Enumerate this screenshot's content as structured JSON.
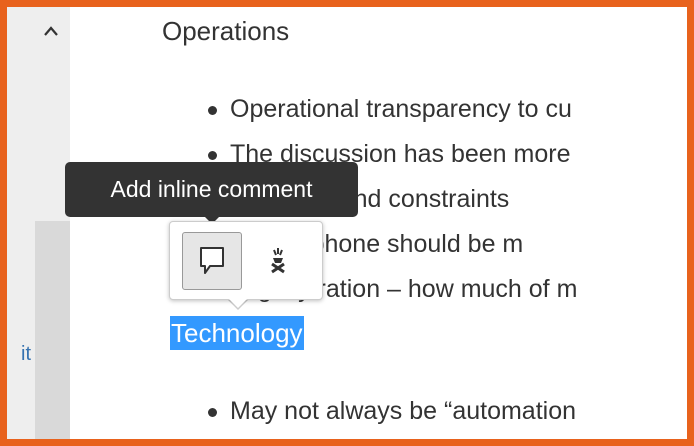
{
  "document": {
    "heading": "Operations",
    "bullets": [
      "Operational transparency to cu",
      "The discussion has been more",
      "Accuracy and constraints",
      "mobile phone should be m",
      "Legacy ration – how much of m",
      "May not always be “automation"
    ],
    "selected_heading": "Technology"
  },
  "sidebar": {
    "link_fragment": "it",
    "scroll_up_icon": "chevron-up-icon"
  },
  "tooltip": {
    "text": "Add inline comment"
  },
  "inline_toolbar": {
    "comment_icon": "speech-bubble-icon",
    "other_icon": "highlight-pen-icon"
  },
  "colors": {
    "frame": "#e8621d",
    "selection": "#3399ff",
    "link": "#3572b0",
    "tooltip_bg": "#333333"
  }
}
